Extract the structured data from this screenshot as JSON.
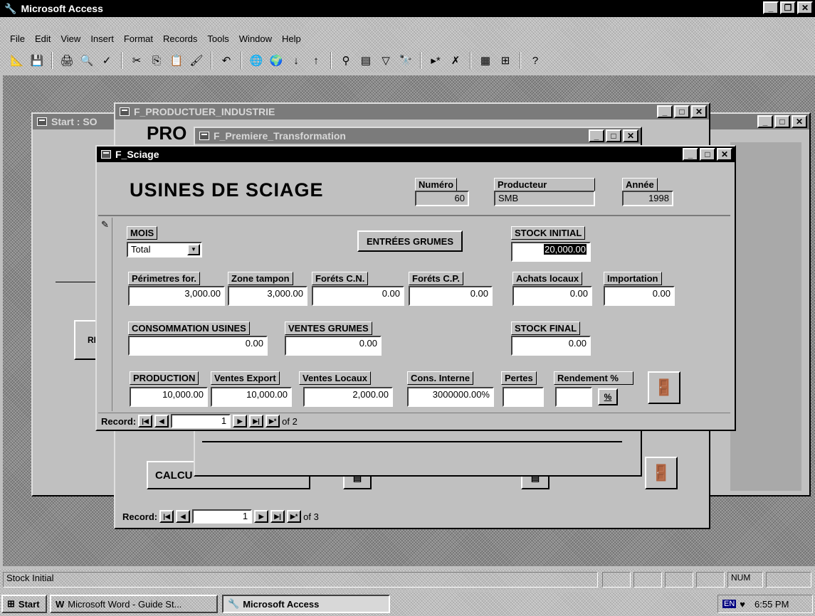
{
  "app": {
    "title": "Microsoft Access"
  },
  "menu": [
    "File",
    "Edit",
    "View",
    "Insert",
    "Format",
    "Records",
    "Tools",
    "Window",
    "Help"
  ],
  "toolbar_icons": [
    "design-view-icon",
    "save-icon",
    "print-icon",
    "print-preview-icon",
    "spelling-icon",
    "cut-icon",
    "copy-icon",
    "paste-icon",
    "format-painter-icon",
    "undo-icon",
    "insert-hyperlink-icon",
    "web-toolbar-icon",
    "sort-ascending-icon",
    "sort-descending-icon",
    "filter-by-selection-icon",
    "filter-by-form-icon",
    "apply-filter-icon",
    "find-icon",
    "new-record-icon",
    "delete-record-icon",
    "database-window-icon",
    "new-object-icon",
    "help-icon"
  ],
  "windows": {
    "start": {
      "title": "Start : SO"
    },
    "producteur": {
      "title": "F_PRODUCTUER_INDUSTRIE",
      "heading_partial": "PRO",
      "calc_button": "CALCU",
      "record_label": "Record:",
      "record_number": "1",
      "record_total": "of 3"
    },
    "premiere": {
      "title": "F_Premiere_Transformation"
    },
    "sciage": {
      "title": "F_Sciage",
      "heading": "USINES DE SCIAGE",
      "numero_label": "Numéro",
      "numero_value": "60",
      "producteur_label": "Producteur",
      "producteur_value": "SMB",
      "annee_label": "Année",
      "annee_value": "1998",
      "mois_label": "MOIS",
      "mois_value": "Total",
      "entrees_button": "ENTRÉES GRUMES",
      "stock_initial_label": "STOCK INITIAL",
      "stock_initial_value": "20,000.00",
      "perimetres_label": "Périmetres for.",
      "perimetres_value": "3,000.00",
      "zone_label": "Zone tampon",
      "zone_value": "3,000.00",
      "forets_cn_label": "Foréts C.N.",
      "forets_cn_value": "0.00",
      "forets_cp_label": "Foréts C.P.",
      "forets_cp_value": "0.00",
      "achats_label": "Achats locaux",
      "achats_value": "0.00",
      "importation_label": "Importation",
      "importation_value": "0.00",
      "consommation_label": "CONSOMMATION USINES",
      "consommation_value": "0.00",
      "ventes_grumes_label": "VENTES GRUMES",
      "ventes_grumes_value": "0.00",
      "stock_final_label": "STOCK FINAL",
      "stock_final_value": "0.00",
      "production_label": "PRODUCTION",
      "production_value": "10,000.00",
      "ventes_export_label": "Ventes Export",
      "ventes_export_value": "10,000.00",
      "ventes_locaux_label": "Ventes Locaux",
      "ventes_locaux_value": "2,000.00",
      "cons_interne_label": "Cons. Interne",
      "cons_interne_value": "3000000.00%",
      "pertes_label": "Pertes",
      "rendement_label": "Rendement %",
      "percent_button": "%",
      "record_label": "Record:",
      "record_number": "1",
      "record_total": "of 2"
    },
    "background_label": "REST"
  },
  "status": {
    "text": "Stock Initial",
    "num": "NUM"
  },
  "taskbar": {
    "start": "Start",
    "tasks": [
      "Microsoft Word - Guide St...",
      "Microsoft Access"
    ],
    "lang": "EN",
    "clock": "6:55 PM"
  }
}
